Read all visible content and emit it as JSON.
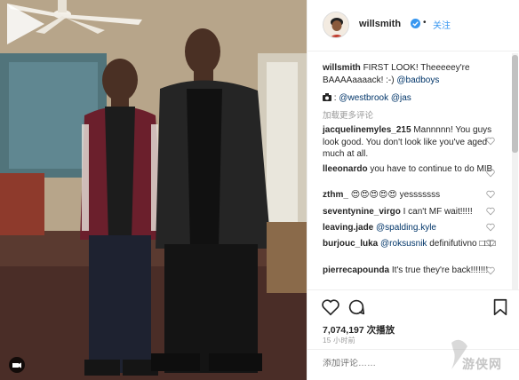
{
  "post": {
    "username": "willsmith",
    "follow_label": "关注",
    "dot": "•",
    "caption_user": "willsmith",
    "caption_text": "FIRST LOOK! Theeeeey're BAAAAaaaack! :-) ",
    "caption_mention": "@badboys",
    "credit_mention_1": "@westbrook",
    "credit_mention_2": "@jas",
    "load_more": "加载更多评论",
    "views": "7,074,197 次播放",
    "time": "15 小时前",
    "add_comment_placeholder": "添加评论……"
  },
  "comments": [
    {
      "user": "jacquelinemyles_215",
      "text": "Mannnnn! You guys look good. You don't look like you've aged much at all."
    },
    {
      "user": "lleeonardo",
      "text": "you have to continue to do MIB"
    },
    {
      "user": "zthm_",
      "text": "😍😍😍😍😍 yesssssss"
    },
    {
      "user": "seventynine_virgo",
      "text": "I can't MF wait!!!!!"
    },
    {
      "user": "leaving.jade",
      "mention": "@spalding.kyle"
    },
    {
      "user": "burjouc_luka",
      "mention": "@roksusnik",
      "text": "definifutivno",
      "tail": "□□□"
    },
    {
      "user": "pierrecapounda",
      "text": "It's true they're back!!!!!!!"
    }
  ],
  "watermark": "游侠网",
  "colors": {
    "link": "#3897f0",
    "mention": "#003569",
    "muted": "#999999",
    "text": "#262626"
  },
  "icons": [
    "play-icon",
    "camera-icon",
    "verified-badge-icon",
    "heart-icon",
    "comment-icon",
    "bookmark-icon"
  ]
}
